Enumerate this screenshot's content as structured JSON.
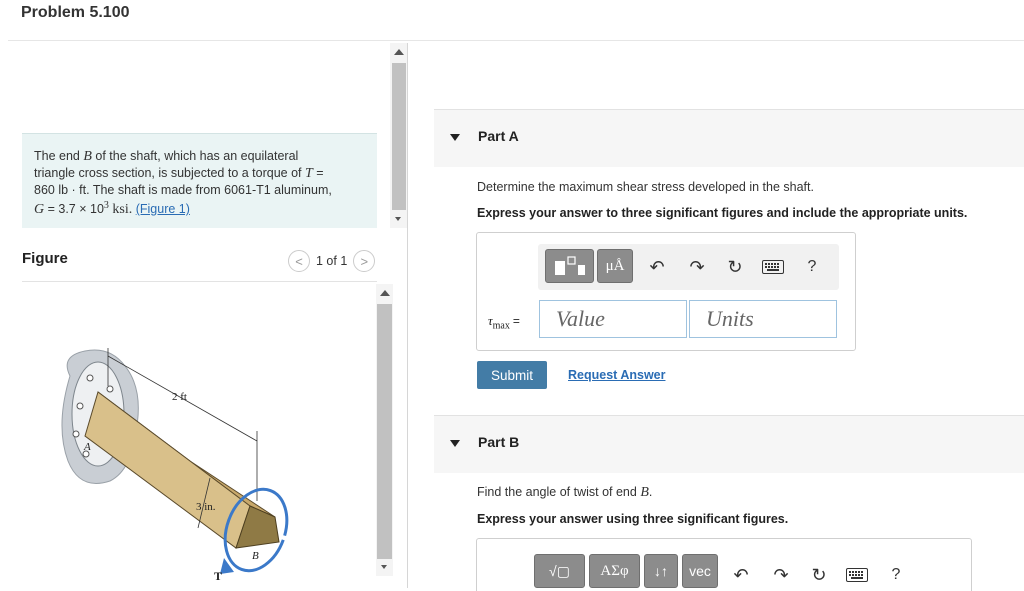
{
  "problem": {
    "title": "Problem 5.100",
    "text_prefix": "The end",
    "end_var": "B",
    "text_mid1": "of the shaft, which has an equilateral triangle cross section, is subjected to a torque of",
    "torque_var": "T",
    "torque_value": "= 860 lb · ft",
    "text_mid2": ". The shaft is made from 6061-T1 aluminum,",
    "g_var": "G",
    "g_value": "= 3.7 × 10",
    "g_exp": "3",
    "g_unit": "ksi.",
    "figure_link": "(Figure 1)"
  },
  "figure": {
    "label": "Figure",
    "pager_text": "1 of 1",
    "prev_glyph": "<",
    "next_glyph": ">",
    "dim_length": "2 ft",
    "dim_side": "3 in.",
    "label_a": "A",
    "label_b": "B",
    "label_t": "T",
    "colors": {
      "shaft": "#d9c08a",
      "wall": "#c9ced4",
      "torque_arrow": "#3b79c9"
    }
  },
  "partA": {
    "header": "Part A",
    "prompt": "Determine the maximum shear stress developed in the shaft.",
    "instruction": "Express your answer to three significant figures and include the appropriate units.",
    "var_symbol": "τ",
    "var_sub": "max",
    "equals": "=",
    "value_placeholder": "Value",
    "units_placeholder": "Units",
    "toolbar": {
      "templates_icon": "templates-icon",
      "units_label": "μÅ",
      "undo_icon": "undo-icon",
      "redo_icon": "redo-icon",
      "reset_icon": "reset-icon",
      "keyboard_icon": "keyboard-icon",
      "help": "?"
    },
    "submit": "Submit",
    "request_answer": "Request Answer"
  },
  "partB": {
    "header": "Part B",
    "prompt_prefix": "Find the angle of twist of end",
    "prompt_var": "B",
    "prompt_suffix": ".",
    "instruction": "Express your answer using three significant figures.",
    "toolbar": {
      "sqrt_label": "√▢",
      "greek_label": "ΑΣφ",
      "arrows_label": "↓↑",
      "vec_label": "vec",
      "help": "?"
    }
  }
}
